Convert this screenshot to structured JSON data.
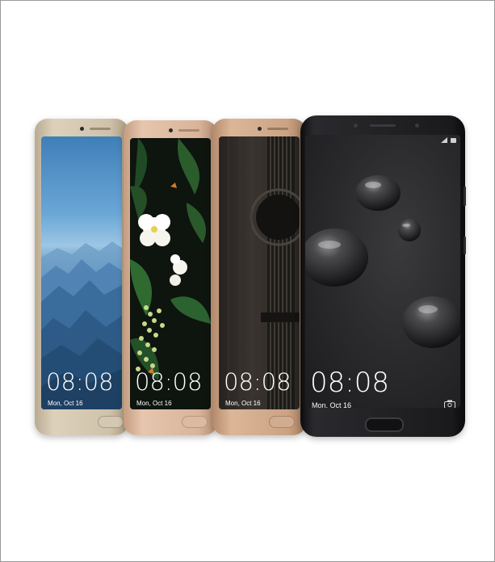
{
  "phones": [
    {
      "name": "gold",
      "clock": "08:08",
      "date": "Mon, Oct 16",
      "body_color": "#cdbfa6",
      "wallpaper": "mountains"
    },
    {
      "name": "pink-gold",
      "clock": "08:08",
      "date": "Mon, Oct 16",
      "body_color": "#d9b59b",
      "wallpaper": "flowers"
    },
    {
      "name": "mocha-brown",
      "clock": "08:08",
      "date": "Mon, Oct 16",
      "body_color": "#c9a184",
      "wallpaper": "guitar"
    },
    {
      "name": "black",
      "clock": "08:08",
      "date": "Mon, Oct 16",
      "body_color": "#1c1c1e",
      "wallpaper": "water-drops"
    }
  ]
}
